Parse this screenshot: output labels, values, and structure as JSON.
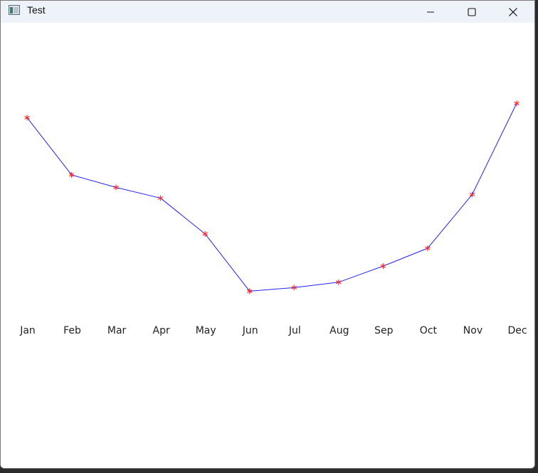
{
  "window": {
    "title": "Test",
    "controls": {
      "minimize_icon": "minimize-icon",
      "maximize_icon": "maximize-icon",
      "close_icon": "close-icon"
    }
  },
  "chart_data": {
    "type": "line",
    "categories": [
      "Jan",
      "Feb",
      "Mar",
      "Apr",
      "May",
      "Jun",
      "Jul",
      "Aug",
      "Sep",
      "Oct",
      "Nov",
      "Dec"
    ],
    "values": [
      96,
      64,
      57,
      51,
      31,
      -1,
      1,
      4,
      13,
      23,
      53,
      104
    ],
    "ylim": [
      -10,
      120
    ],
    "grid": false,
    "marker": "asterisk",
    "line_color": "#2222ff",
    "marker_color": "#ff2222",
    "title": "",
    "xlabel": "",
    "ylabel": ""
  }
}
